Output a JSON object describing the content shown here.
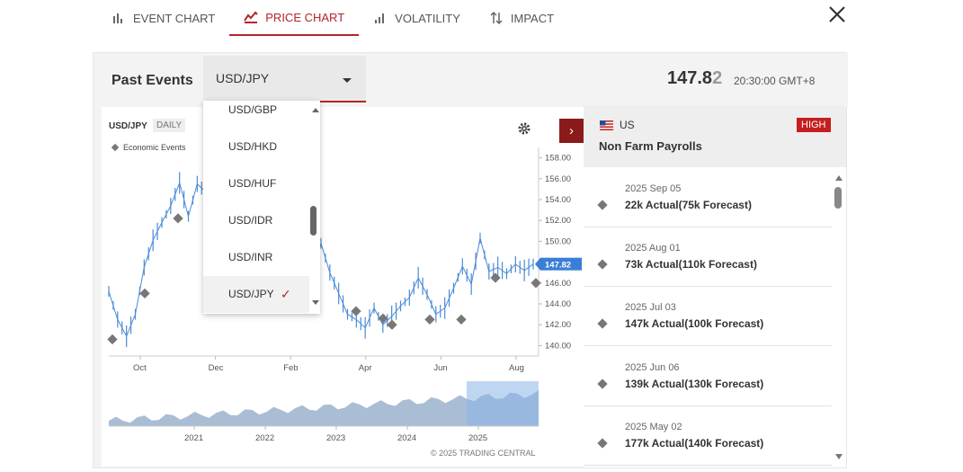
{
  "tabs": [
    {
      "label": "EVENT CHART",
      "icon": "bar-chart-icon"
    },
    {
      "label": "PRICE CHART",
      "icon": "price-chart-icon"
    },
    {
      "label": "VOLATILITY",
      "icon": "volatility-icon"
    },
    {
      "label": "IMPACT",
      "icon": "impact-arrows-icon"
    }
  ],
  "active_tab": "PRICE CHART",
  "header": {
    "title": "Past Events",
    "symbol": "USD/JPY",
    "price_main": "147.8",
    "price_last_digit": "2",
    "time": "20:30:00 GMT+8"
  },
  "dropdown": {
    "items": [
      "USD/GBP",
      "USD/HKD",
      "USD/HUF",
      "USD/IDR",
      "USD/INR",
      "USD/JPY"
    ],
    "selected": "USD/JPY",
    "check": "✓"
  },
  "chart": {
    "symbol": "USD/JPY",
    "interval": "DAILY",
    "legend_label": "Economic Events",
    "current_price_label": "147.82",
    "copyright": "© 2025 TRADING CENTRAL",
    "arrow": "›"
  },
  "chart_data": {
    "type": "line",
    "title": "",
    "ylabel": "",
    "ylim": [
      139,
      159
    ],
    "y_ticks": [
      "158.00",
      "156.00",
      "154.00",
      "152.00",
      "150.00",
      "148.00",
      "146.00",
      "144.00",
      "142.00",
      "140.00"
    ],
    "x_ticks": [
      "Oct",
      "Dec",
      "Feb",
      "Apr",
      "Jun",
      "Aug"
    ],
    "series": [
      {
        "values": [
          145.2,
          142.5,
          140.9,
          143.0,
          147.5,
          150.1,
          151.8,
          153.4,
          155.6,
          152.4,
          155.5,
          154.7,
          157.0,
          154.3,
          156.3,
          155.0,
          154.0,
          152.0,
          151.6,
          150.3,
          149.5,
          149.8,
          150.5,
          147.5,
          149.8,
          147.0,
          145.0,
          143.0,
          142.5,
          141.7,
          143.6,
          142.0,
          142.8,
          143.8,
          144.6,
          146.5,
          144.9,
          143.0,
          143.6,
          145.5,
          147.6,
          145.9,
          150.3,
          147.1,
          147.5,
          146.9,
          147.8,
          147.2,
          147.82
        ]
      }
    ],
    "event_markers": [
      {
        "x": "Sep",
        "y": 140.6
      },
      {
        "x": "Oct",
        "y": 145.0
      },
      {
        "x": "Nov",
        "y": 152.2
      },
      {
        "x": "Apr",
        "y": 143.3
      },
      {
        "x": "Apr",
        "y": 142.6
      },
      {
        "x": "May",
        "y": 142.0
      },
      {
        "x": "Jun",
        "y": 142.5
      },
      {
        "x": "Jul",
        "y": 142.5
      },
      {
        "x": "Aug",
        "y": 146.5
      },
      {
        "x": "Sep",
        "y": 146.0
      }
    ],
    "overview": {
      "x_ticks": [
        "2021",
        "2022",
        "2023",
        "2024",
        "2025"
      ]
    }
  },
  "event": {
    "country": "US",
    "name": "Non Farm Payrolls",
    "impact": "HIGH"
  },
  "history": [
    {
      "date": "2025 Sep 05",
      "value": "22k Actual(75k Forecast)"
    },
    {
      "date": "2025 Aug 01",
      "value": "73k Actual(110k Forecast)"
    },
    {
      "date": "2025 Jul 03",
      "value": "147k Actual(100k Forecast)"
    },
    {
      "date": "2025 Jun 06",
      "value": "139k Actual(130k Forecast)"
    },
    {
      "date": "2025 May 02",
      "value": "177k Actual(140k Forecast)"
    }
  ],
  "colors": {
    "accent": "#b3242a",
    "line": "#4a8bd6",
    "overview_fill": "#a9bdd4",
    "overview_highlight": "#8ab4e8",
    "badge": "#c41e1e",
    "price_tag": "#3a7fd5"
  }
}
